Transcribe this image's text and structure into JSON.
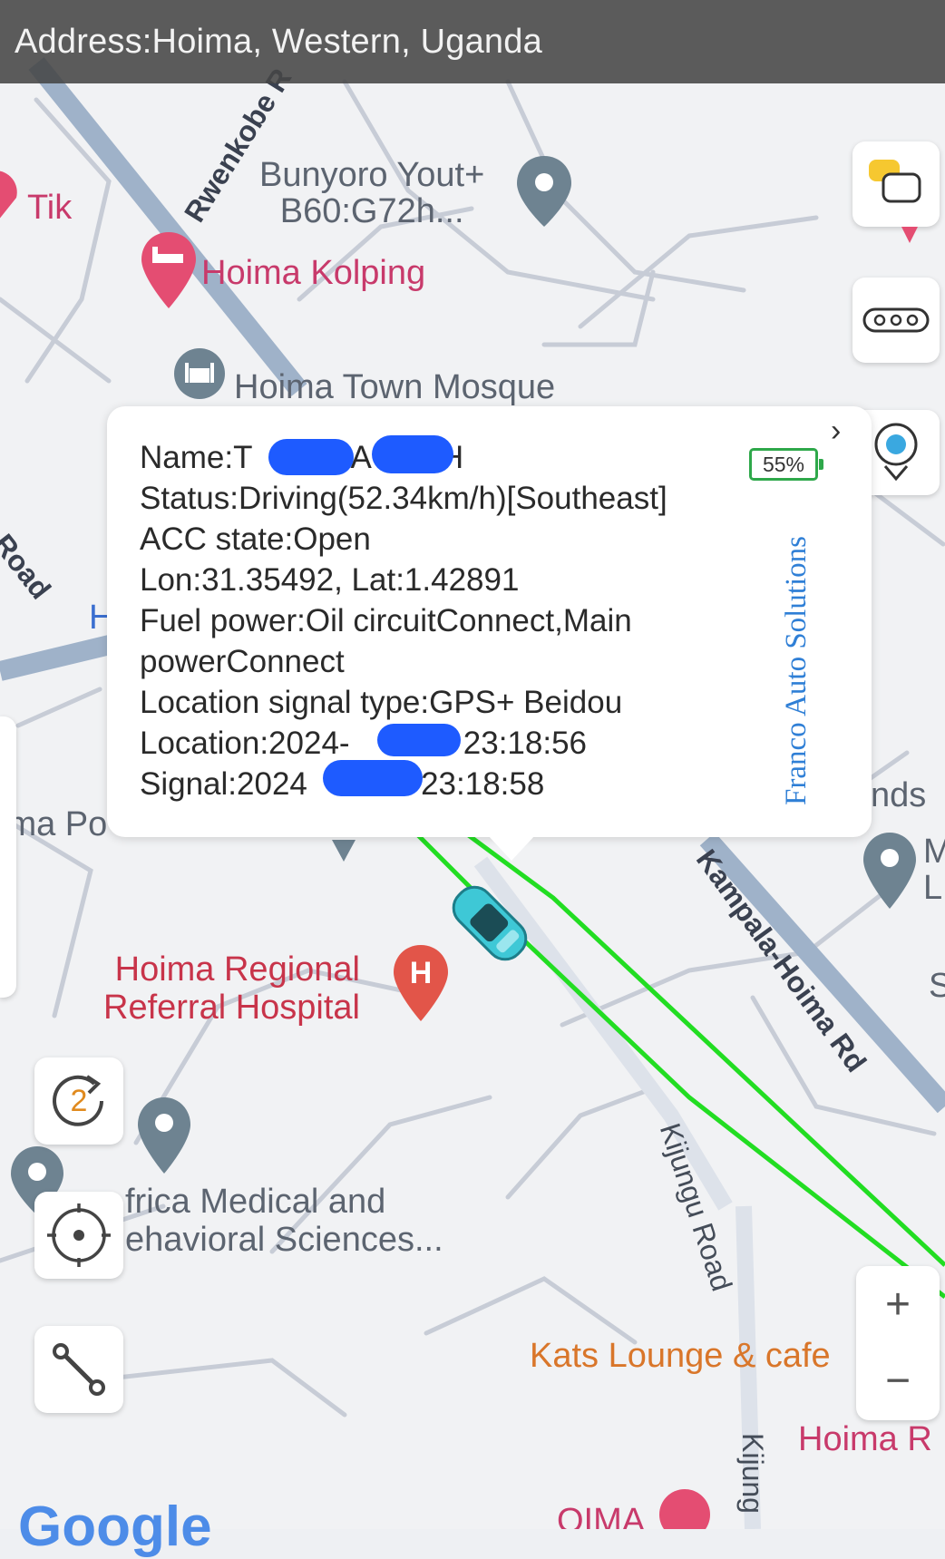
{
  "header": {
    "address": "Address:Hoima, Western, Uganda"
  },
  "map": {
    "pois": {
      "tik": "Tik",
      "bunyoro_line1": "Bunyoro Yout+",
      "bunyoro_line2": "B60:G72h...",
      "kolping": "Hoima Kolping",
      "mosque": "Hoima Town Mosque",
      "hospital_line1": "Hoima Regional",
      "hospital_line2": "Referral Hospital",
      "africa_line1": "frica Medical and",
      "africa_line2": "ehavioral Sciences...",
      "kats": "Kats Lounge & cafe",
      "hoima_po": "ima Po",
      "hoima_r": "Hoima R",
      "nds": "nds",
      "m_letter": "M",
      "l_letter": "L",
      "s_letter": "S",
      "h_letter": "H",
      "hoima_bottom": "OIMA"
    },
    "roads": {
      "rwenkobe": "Rwenkobe R",
      "road_left": "Road",
      "kampala_hoima": "Kampala-Hoima Rd",
      "kijungu": "Kijungu Road",
      "kijungu_bottom": "Kijung"
    },
    "google_logo": "Google"
  },
  "controls": {
    "refresh_count": "2",
    "zoom_in": "+",
    "zoom_out": "−"
  },
  "popup": {
    "name": "Name:T",
    "name_tail": "A",
    "name_end": "H",
    "status": "Status:Driving(52.34km/h)[Southeast]",
    "acc": "ACC state:Open",
    "lonlat": "Lon:31.35492, Lat:1.42891",
    "fuel_line1": "Fuel power:Oil circuitConnect,Main",
    "fuel_line2": "powerConnect",
    "signal_type": "Location signal type:GPS+ Beidou",
    "location_prefix": "Location:2024-",
    "location_time": "7 23:18:56",
    "signal_prefix": "Signal:2024",
    "signal_time": "7 23:18:58",
    "battery": "55%",
    "brand": "Franco Auto Solutions"
  },
  "colors": {
    "track": "#22dd22",
    "vehicle": "#3ec8d6",
    "accent_blue": "#2f7fd6",
    "redaction": "#1e5bff"
  }
}
